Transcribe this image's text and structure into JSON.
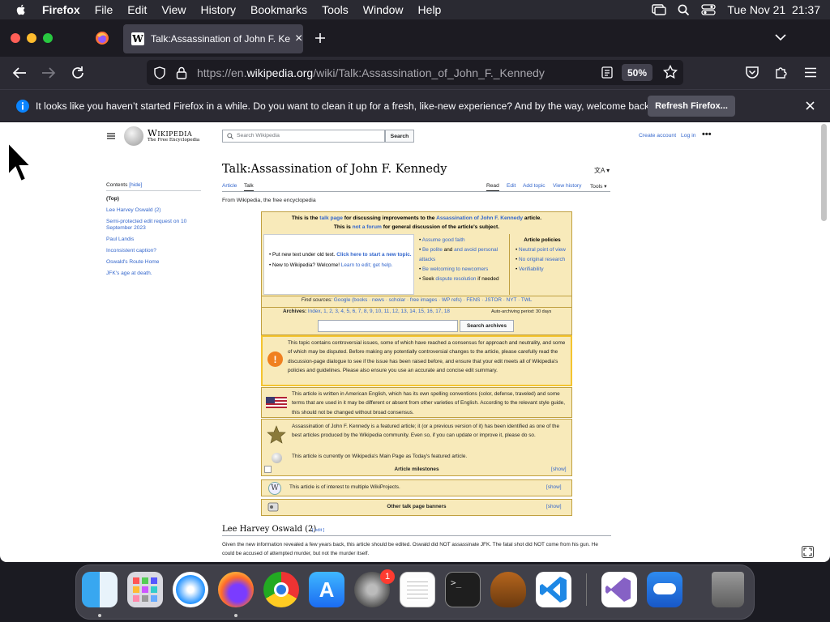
{
  "menubar": {
    "app": "Firefox",
    "items": [
      "File",
      "Edit",
      "View",
      "History",
      "Bookmarks",
      "Tools",
      "Window",
      "Help"
    ],
    "datetime": "Tue Nov 21  21:37"
  },
  "browser": {
    "tab_title": "Talk:Assassination of John F. Ke",
    "url_prefix": "https://en.",
    "url_domain": "wikipedia.org",
    "url_path": "/wiki/Talk:Assassination_of_John_F._Kennedy",
    "zoom": "50%"
  },
  "notification": {
    "text": "It looks like you haven’t started Firefox in a while. Do you want to clean it up for a fresh, like-new experience? And by the way, welcome back!",
    "button": "Refresh Firefox..."
  },
  "wiki": {
    "logo_title": "Wikipedia",
    "logo_sub": "The Free Encyclopedia",
    "search_placeholder": "Search Wikipedia",
    "search_button": "Search",
    "create_account": "Create account",
    "login": "Log in",
    "title": "Talk:Assassination of John F. Kennedy",
    "tabs_left": [
      "Article",
      "Talk"
    ],
    "tabs_right": [
      "Read",
      "Edit",
      "Add topic",
      "View history",
      "Tools"
    ],
    "from": "From Wikipedia, the free encyclopedia",
    "contents_label": "Contents",
    "contents_hide": "[hide]",
    "toc": [
      "(Top)",
      "Lee Harvey Oswald (2)",
      "Semi-protected edit request on 10 September 2023",
      "Paul Landis",
      "Inconsistent caption?",
      "Oswald's Route Home",
      "JFK's age at death."
    ],
    "header_line1_a": "This is the ",
    "header_line1_link1": "talk page",
    "header_line1_b": " for discussing improvements to the ",
    "header_line1_link2": "Assassination of John F. Kennedy",
    "header_line1_c": " article.",
    "header_line2_a": "This is ",
    "header_line2_link": "not a forum",
    "header_line2_b": " for general discussion of the article's subject.",
    "put_new": "Put new text under old text. ",
    "click_here": "Click here to start a new topic.",
    "new_to": "New to Wikipedia? Welcome! ",
    "learn": "Learn to edit; get help.",
    "tips": [
      "Assume good faith",
      "Be polite",
      "and avoid personal attacks",
      "Be welcoming to newcomers",
      "Seek ",
      "dispute resolution",
      " if needed"
    ],
    "policies_title": "Article policies",
    "policies": [
      "Neutral point of view",
      "No original research",
      "Verifiability"
    ],
    "find_sources_label": "Find sources:",
    "find_sources": "Google (books · news · scholar · free images · WP refs) · FENS · JSTOR · NYT · TWL",
    "archives_label": "Archives:",
    "archives": "Index, 1, 2, 3, 4, 5, 6, 7, 8, 9, 10, 11, 12, 13, 14, 15, 16, 17, 18",
    "auto_archiving": "Auto-archiving period: 30 days",
    "search_archives": "Search archives",
    "controversial": "This topic contains controversial issues, some of which have reached a consensus for approach and neutrality, and some of which may be disputed. Before making any potentially controversial changes to the article, please carefully read the discussion-page dialogue to see if the issue has been raised before, and ensure that your edit meets all of Wikipedia's policies and guidelines. Please also ensure you use an accurate and concise edit summary.",
    "american": "This article is written in American English, which has its own spelling conventions (color, defense, traveled) and some terms that are used in it may be different or absent from other varieties of English. According to the relevant style guide, this should not be changed without broad consensus.",
    "featured": "Assassination of John F. Kennedy is a featured article; it (or a previous version of it) has been identified as one of the best articles produced by the Wikipedia community. Even so, if you can update or improve it, please do so.",
    "mainpage": "This article is currently on Wikipedia's Main Page as Today's featured article.",
    "milestones": "Article milestones",
    "show": "[show]",
    "wikiprojects": "This article is of interest to multiple WikiProjects.",
    "other_banners": "Other talk page banners",
    "section_title": "Lee Harvey Oswald (2)",
    "section_edit": "[ edit ]",
    "section_text": "Given the new information revealed a few years back, this article should be edited. Oswald did NOT assassinate JFK. The fatal shot did NOT come from his gun. He could be accused of attempted murder, but not the murder itself."
  },
  "dock": {
    "badge_count": "1",
    "apps": [
      "finder-icon",
      "launchpad-icon",
      "safari-icon",
      "firefox-icon",
      "chrome-icon",
      "app-store-icon",
      "system-settings-icon",
      "textedit-icon",
      "terminal-icon",
      "garageband-icon",
      "vscode-icon",
      "visual-studio-icon",
      "weather-icon",
      "trash-icon"
    ]
  }
}
